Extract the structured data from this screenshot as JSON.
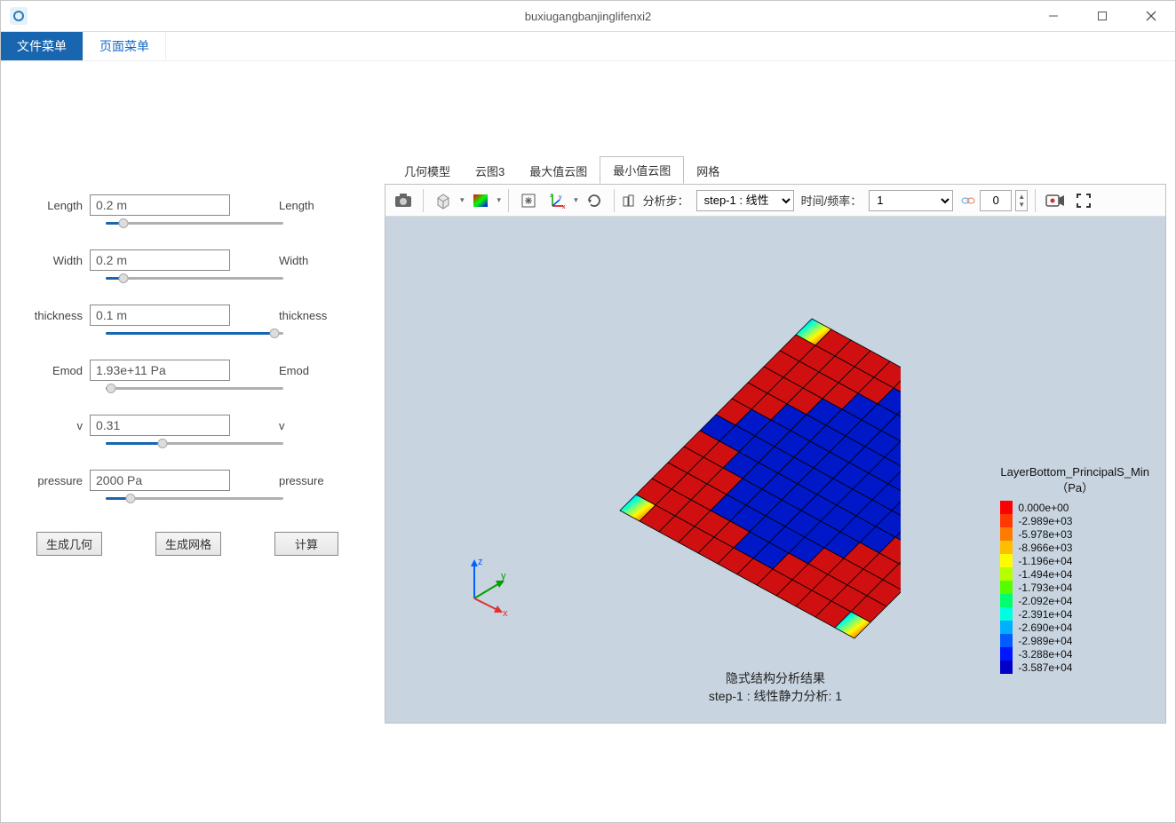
{
  "window": {
    "title": "buxiugangbanjinglifenxi2"
  },
  "menu": {
    "file": "文件菜单",
    "page": "页面菜单"
  },
  "params": {
    "length": {
      "label": "Length",
      "value": "0.2 m",
      "rlabel": "Length",
      "ratio": 10
    },
    "width": {
      "label": "Width",
      "value": "0.2 m",
      "rlabel": "Width",
      "ratio": 10
    },
    "thickness": {
      "label": "thickness",
      "value": "0.1 m",
      "rlabel": "thickness",
      "ratio": 95
    },
    "emod": {
      "label": "Emod",
      "value": "1.93e+11 Pa",
      "rlabel": "Emod",
      "ratio": 3
    },
    "v": {
      "label": "v",
      "value": "0.31",
      "rlabel": "v",
      "ratio": 32
    },
    "pressure": {
      "label": "pressure",
      "value": "2000 Pa",
      "rlabel": "pressure",
      "ratio": 14
    }
  },
  "actions": {
    "gen_geometry": "生成几何",
    "gen_mesh": "生成网格",
    "compute": "计算"
  },
  "tabs": {
    "geom": "几何模型",
    "cloud3": "云图3",
    "max": "最大值云图",
    "min": "最小值云图",
    "mesh": "网格"
  },
  "toolbar": {
    "step_label": "分析步：",
    "step_value": "step-1 : 线性",
    "time_label": "时间/频率：",
    "time_value": "1",
    "frame_value": "0"
  },
  "result": {
    "label1": "隐式结构分析结果",
    "label2": "step-1 : 线性静力分析: 1"
  },
  "legend": {
    "title": "LayerBottom_PrincipalS_Min",
    "unit": "（Pa）",
    "items": [
      {
        "value": "0.000e+00",
        "color": "#ff0000"
      },
      {
        "value": "-2.989e+03",
        "color": "#ff3a00"
      },
      {
        "value": "-5.978e+03",
        "color": "#ff7a00"
      },
      {
        "value": "-8.966e+03",
        "color": "#ffbe00"
      },
      {
        "value": "-1.196e+04",
        "color": "#fffb00"
      },
      {
        "value": "-1.494e+04",
        "color": "#b7ff00"
      },
      {
        "value": "-1.793e+04",
        "color": "#55ff00"
      },
      {
        "value": "-2.092e+04",
        "color": "#00ff6e"
      },
      {
        "value": "-2.391e+04",
        "color": "#00ffe0"
      },
      {
        "value": "-2.690e+04",
        "color": "#00b0ff"
      },
      {
        "value": "-2.989e+04",
        "color": "#005cff"
      },
      {
        "value": "-3.288e+04",
        "color": "#0016ff"
      },
      {
        "value": "-3.587e+04",
        "color": "#0000c8"
      }
    ]
  },
  "chart_data": {
    "type": "heatmap",
    "title": "LayerBottom_PrincipalS_Min",
    "unit": "Pa",
    "grid_size": 12,
    "description": "12x12 shell element contour. Outer ring predominantly red (≈0 Pa). Four corner cells show rainbow gradient indicating sharp drop to approximately -3.5e4 Pa. A large central diamond-shaped region of roughly 8x8 cells is blue (≈ -3.2e4 to -3.5e4 Pa) with jagged red/blue boundary.",
    "value_range": [
      -35870,
      0
    ],
    "color_scale": [
      {
        "stop": 0.0,
        "color": "#ff0000",
        "value": 0
      },
      {
        "stop": 0.5,
        "color": "#00ff6e",
        "value": -17930
      },
      {
        "stop": 1.0,
        "color": "#0000c8",
        "value": -35870
      }
    ]
  }
}
